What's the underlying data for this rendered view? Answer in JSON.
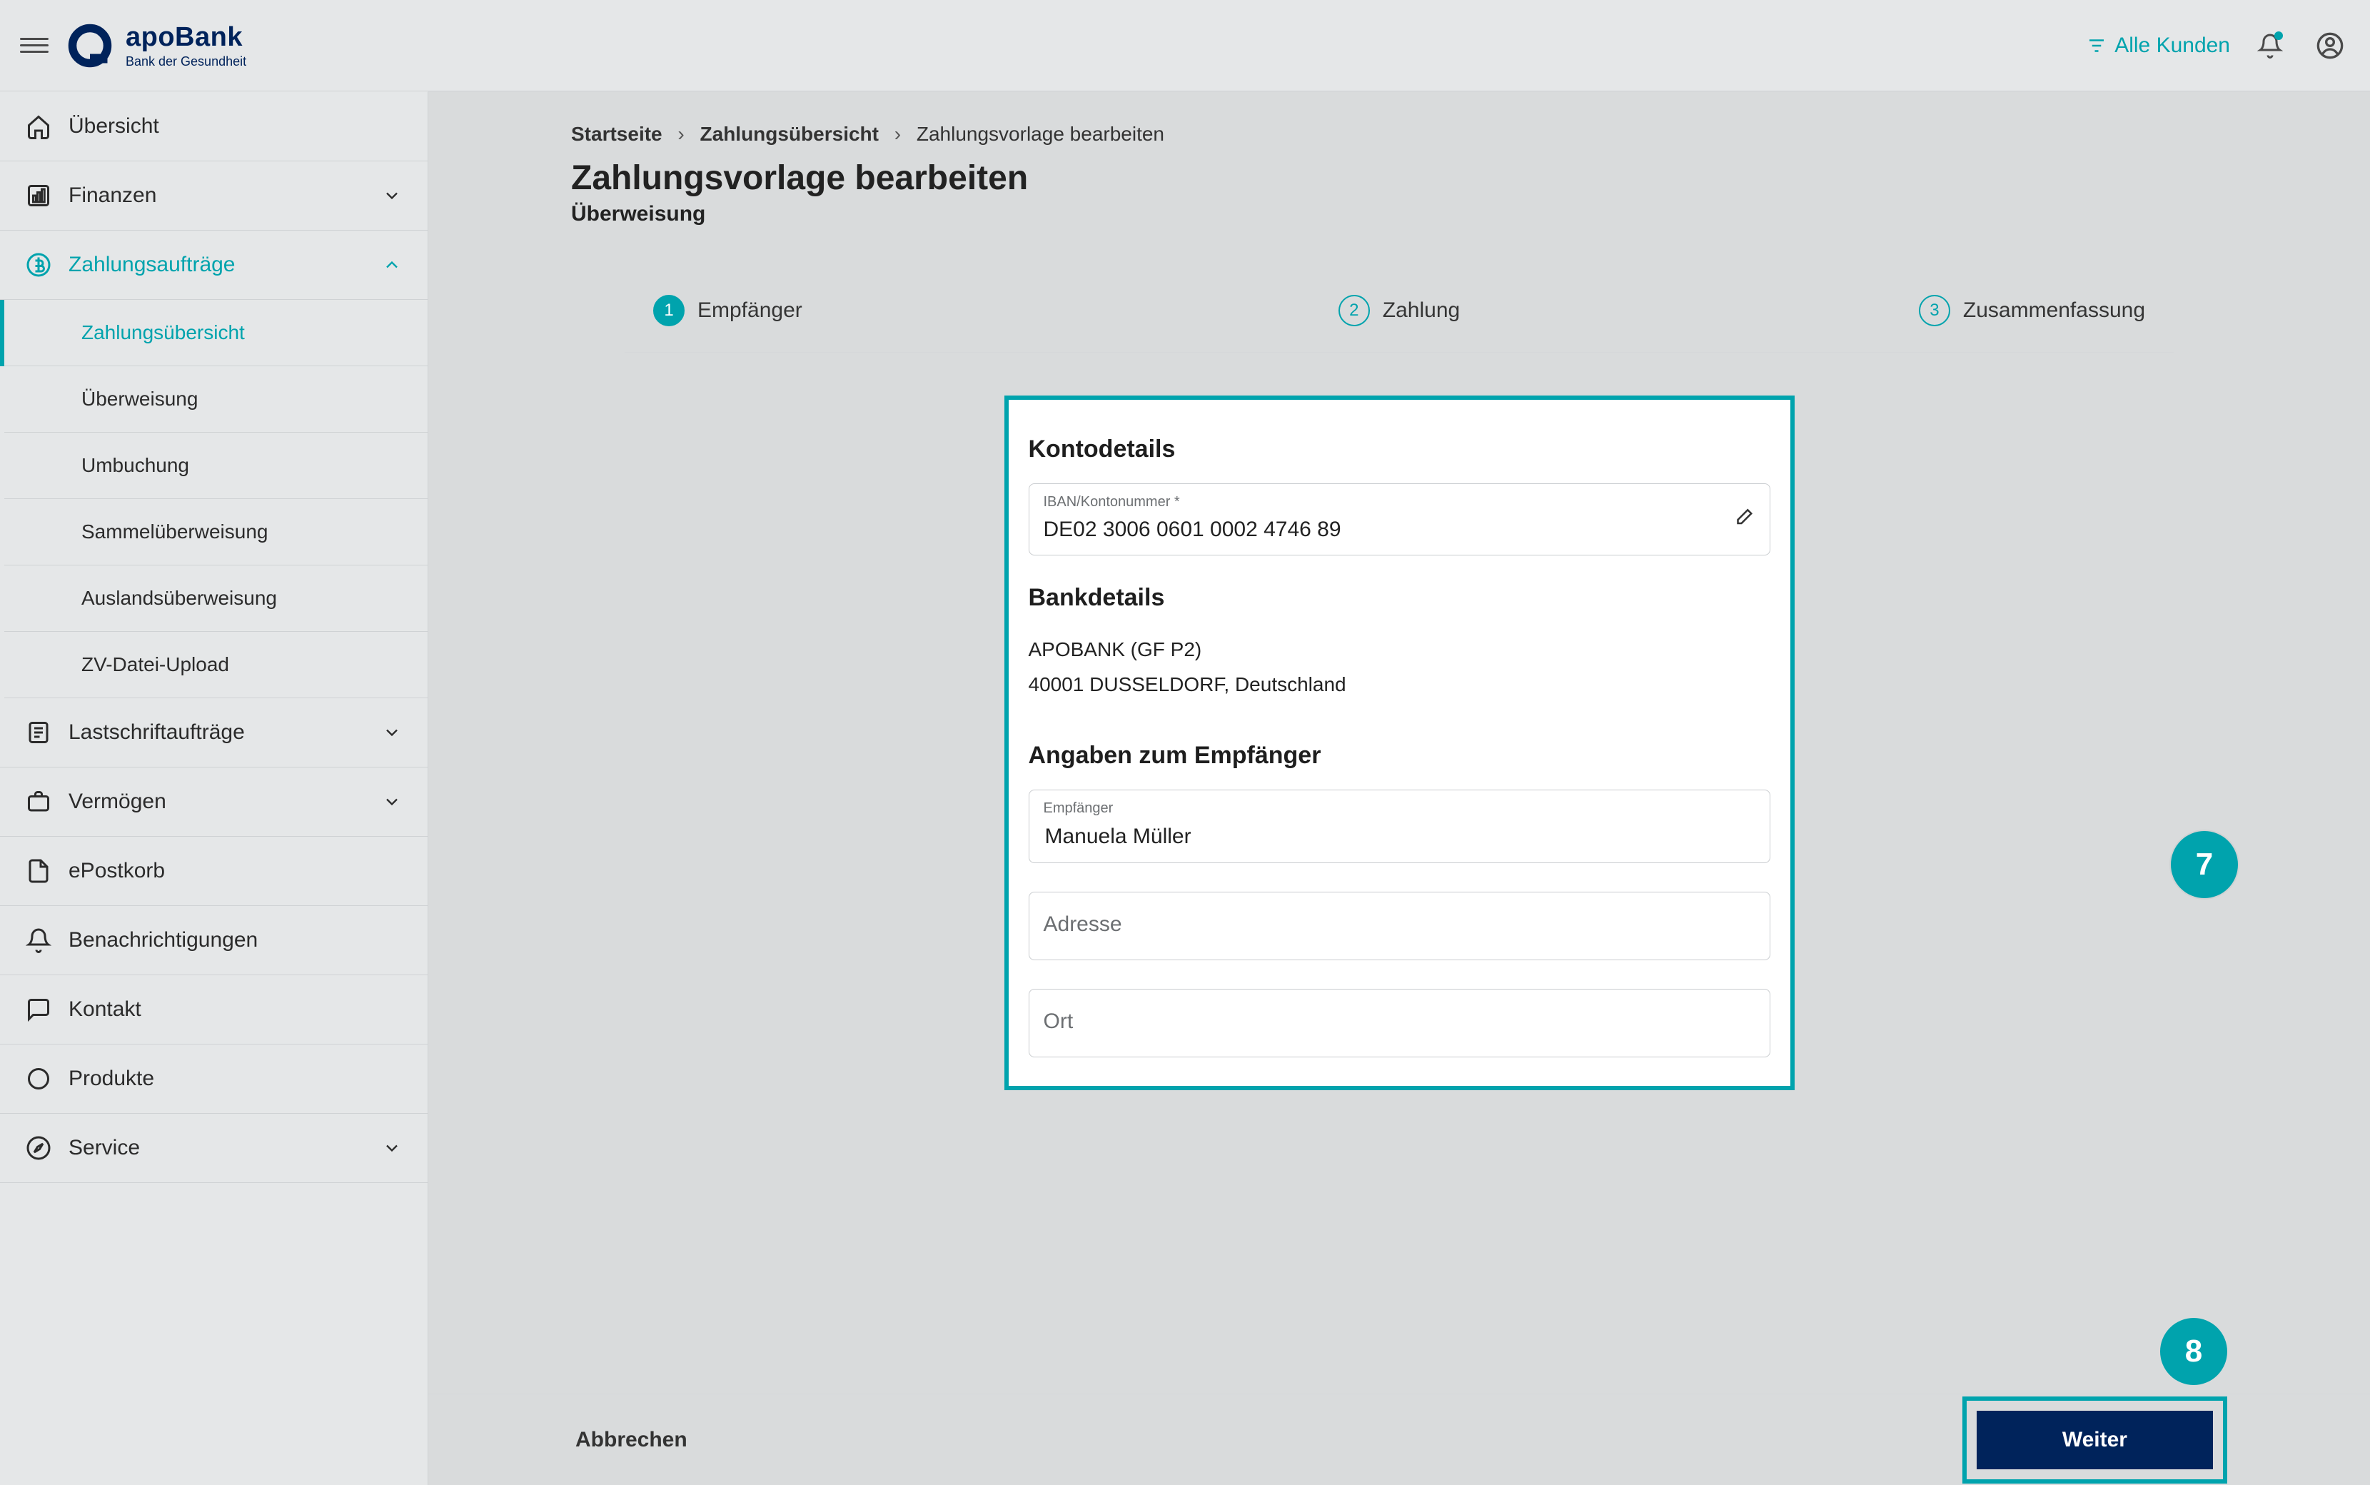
{
  "brand": {
    "name": "apoBank",
    "tagline": "Bank der Gesundheit"
  },
  "header": {
    "customers_label": "Alle Kunden"
  },
  "sidebar": {
    "items": [
      {
        "icon": "home",
        "label": "Übersicht",
        "expandable": false
      },
      {
        "icon": "finance",
        "label": "Finanzen",
        "expandable": true,
        "open": false
      },
      {
        "icon": "payments",
        "label": "Zahlungsaufträge",
        "expandable": true,
        "open": true,
        "children": [
          {
            "label": "Zahlungsübersicht",
            "active": true
          },
          {
            "label": "Überweisung"
          },
          {
            "label": "Umbuchung"
          },
          {
            "label": "Sammelüberweisung"
          },
          {
            "label": "Auslandsüberweisung"
          },
          {
            "label": "ZV-Datei-Upload"
          }
        ]
      },
      {
        "icon": "debit",
        "label": "Lastschriftaufträge",
        "expandable": true
      },
      {
        "icon": "wealth",
        "label": "Vermögen",
        "expandable": true
      },
      {
        "icon": "mail",
        "label": "ePostkorb",
        "expandable": false
      },
      {
        "icon": "bell",
        "label": "Benachrichtigungen",
        "expandable": false
      },
      {
        "icon": "chat",
        "label": "Kontakt",
        "expandable": false
      },
      {
        "icon": "circle",
        "label": "Produkte",
        "expandable": false
      },
      {
        "icon": "compass",
        "label": "Service",
        "expandable": true
      }
    ]
  },
  "breadcrumb": {
    "items": [
      "Startseite",
      "Zahlungsübersicht",
      "Zahlungsvorlage bearbeiten"
    ]
  },
  "page": {
    "title": "Zahlungsvorlage bearbeiten",
    "subtitle": "Überweisung"
  },
  "stepper": {
    "steps": [
      {
        "n": "1",
        "label": "Empfänger",
        "active": true
      },
      {
        "n": "2",
        "label": "Zahlung",
        "active": false
      },
      {
        "n": "3",
        "label": "Zusammenfassung",
        "active": false
      }
    ]
  },
  "form": {
    "section_account": "Kontodetails",
    "iban_label": "IBAN/Kontonummer *",
    "iban_value": "DE02 3006 0601 0002 4746 89",
    "section_bank": "Bankdetails",
    "bank_name": "APOBANK (GF P2)",
    "bank_addr": "40001 DUSSELDORF, Deutschland",
    "section_recipient": "Angaben zum Empfänger",
    "recipient_label": "Empfänger",
    "recipient_value": "Manuela Müller",
    "address_label": "Adresse",
    "city_label": "Ort"
  },
  "actions": {
    "cancel": "Abbrechen",
    "next": "Weiter"
  },
  "annotations": {
    "a": "7",
    "b": "8"
  }
}
